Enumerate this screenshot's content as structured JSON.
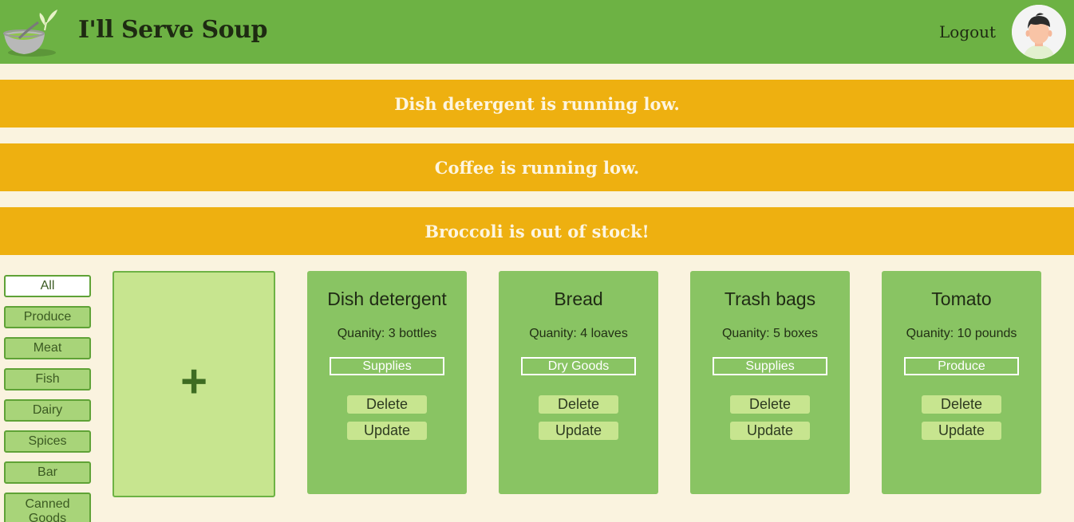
{
  "header": {
    "brand": "I'll Serve Soup",
    "logout_label": "Logout"
  },
  "alerts": [
    "Dish detergent is running low.",
    "Coffee is running low.",
    "Broccoli is out of stock!"
  ],
  "filters": [
    "All",
    "Produce",
    "Meat",
    "Fish",
    "Dairy",
    "Spices",
    "Bar",
    "Canned Goods"
  ],
  "add_card": {
    "label": "+"
  },
  "items": [
    {
      "name": "Dish detergent",
      "quantity": "Quanity: 3 bottles",
      "category": "Supplies",
      "delete_label": "Delete",
      "update_label": "Update"
    },
    {
      "name": "Bread",
      "quantity": "Quanity: 4 loaves",
      "category": "Dry Goods",
      "delete_label": "Delete",
      "update_label": "Update"
    },
    {
      "name": "Trash bags",
      "quantity": "Quanity: 5 boxes",
      "category": "Supplies",
      "delete_label": "Delete",
      "update_label": "Update"
    },
    {
      "name": "Tomato",
      "quantity": "Quanity: 10 pounds",
      "category": "Produce",
      "delete_label": "Delete",
      "update_label": "Update"
    }
  ],
  "colors": {
    "header_bg": "#6db244",
    "page_bg": "#faf3df",
    "alert_bg": "#eeb010",
    "card_bg": "#89c463",
    "add_card_bg": "#c7e58f"
  },
  "icons": {
    "logo": "soup-bowl-icon",
    "avatar": "user-avatar-icon",
    "add": "plus-icon"
  }
}
